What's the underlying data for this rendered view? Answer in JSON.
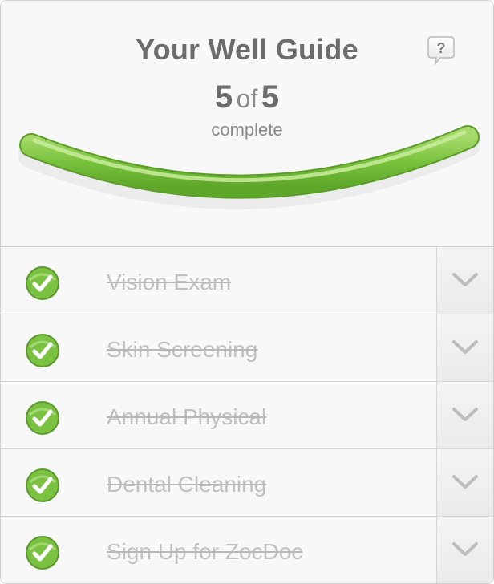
{
  "guide": {
    "title": "Your Well Guide",
    "completed": "5",
    "of_label": "of",
    "total": "5",
    "status": "complete",
    "progress_fraction": 1.0,
    "help_icon": "question-bubble-icon",
    "accent_green": "#7cc242"
  },
  "tasks": [
    {
      "label": "Vision Exam",
      "done": true
    },
    {
      "label": "Skin Screening",
      "done": true
    },
    {
      "label": "Annual Physical",
      "done": true
    },
    {
      "label": "Dental Cleaning",
      "done": true
    },
    {
      "label": "Sign Up for ZocDoc",
      "done": true
    }
  ]
}
